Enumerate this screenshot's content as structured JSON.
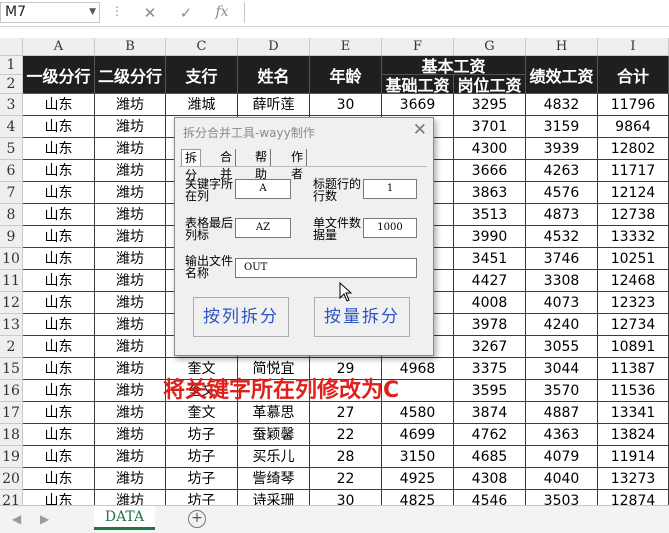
{
  "formula_bar": {
    "name_box": "M7",
    "cancel_icon": "✕",
    "enter_icon": "✓",
    "fx_label": "fx",
    "formula": ""
  },
  "columns": [
    "A",
    "B",
    "C",
    "D",
    "E",
    "F",
    "G",
    "H",
    "I"
  ],
  "header": {
    "row1": [
      "一级分行",
      "二级分行",
      "支行",
      "姓名",
      "年龄",
      "基本工资",
      "绩效工资",
      "合计"
    ],
    "row2": [
      "基础工资",
      "岗位工资"
    ]
  },
  "rows": [
    [
      "3",
      "山东",
      "潍坊",
      "潍城",
      "薛听莲",
      "30",
      "3669",
      "3295",
      "4832",
      "11796"
    ],
    [
      "4",
      "山东",
      "潍坊",
      "",
      "",
      "",
      "",
      "3701",
      "3159",
      "9864"
    ],
    [
      "5",
      "山东",
      "潍坊",
      "",
      "",
      "",
      "",
      "4300",
      "3939",
      "12802"
    ],
    [
      "6",
      "山东",
      "潍坊",
      "",
      "",
      "",
      "",
      "3666",
      "4263",
      "11717"
    ],
    [
      "7",
      "山东",
      "潍坊",
      "",
      "",
      "",
      "",
      "3863",
      "4576",
      "12124"
    ],
    [
      "8",
      "山东",
      "潍坊",
      "",
      "",
      "",
      "",
      "3513",
      "4873",
      "12738"
    ],
    [
      "9",
      "山东",
      "潍坊",
      "",
      "",
      "",
      "",
      "3990",
      "4532",
      "13332"
    ],
    [
      "10",
      "山东",
      "潍坊",
      "",
      "",
      "",
      "",
      "3451",
      "3746",
      "10251"
    ],
    [
      "11",
      "山东",
      "潍坊",
      "",
      "",
      "",
      "",
      "4427",
      "3308",
      "12468"
    ],
    [
      "12",
      "山东",
      "潍坊",
      "",
      "",
      "",
      "",
      "4008",
      "4073",
      "12323"
    ],
    [
      "13",
      "山东",
      "潍坊",
      "",
      "",
      "",
      "",
      "3978",
      "4240",
      "12734"
    ],
    [
      "2",
      "山东",
      "潍坊",
      "",
      "",
      "",
      "",
      "3267",
      "3055",
      "10891"
    ],
    [
      "15",
      "山东",
      "潍坊",
      "奎文",
      "简悦宜",
      "29",
      "4968",
      "3375",
      "3044",
      "11387"
    ],
    [
      "16",
      "山东",
      "潍坊",
      "奎文",
      "",
      "",
      "",
      "3595",
      "3570",
      "11536"
    ],
    [
      "17",
      "山东",
      "潍坊",
      "奎文",
      "革慕思",
      "27",
      "4580",
      "3874",
      "4887",
      "13341"
    ],
    [
      "18",
      "山东",
      "潍坊",
      "坊子",
      "蚕颖馨",
      "22",
      "4699",
      "4762",
      "4363",
      "13824"
    ],
    [
      "19",
      "山东",
      "潍坊",
      "坊子",
      "买乐儿",
      "28",
      "3150",
      "4685",
      "4079",
      "11914"
    ],
    [
      "20",
      "山东",
      "潍坊",
      "坊子",
      "訾绮琴",
      "22",
      "4925",
      "4308",
      "4040",
      "13273"
    ],
    [
      "21",
      "山东",
      "潍坊",
      "坊子",
      "诗采珊",
      "30",
      "4825",
      "4546",
      "3503",
      "12874"
    ]
  ],
  "dialog": {
    "title": "拆分合并工具-wayy制作",
    "close": "✕",
    "tabs": [
      "拆分",
      "合并",
      "帮助",
      "作者"
    ],
    "key_col_label": "关键字所在列",
    "key_col_value": "A",
    "title_rows_label": "标题行的行数",
    "title_rows_value": "1",
    "last_col_label": "表格最后列标",
    "last_col_value": "AZ",
    "per_file_label": "单文件数据量",
    "per_file_value": "1000",
    "output_label": "输出文件名称",
    "output_value": "OUT",
    "split_by_col_button": "按列拆分",
    "split_by_qty_button": "按量拆分"
  },
  "caption": "将关键字所在列修改为C",
  "sheet_tabs": {
    "active": "DATA",
    "add": "+"
  }
}
